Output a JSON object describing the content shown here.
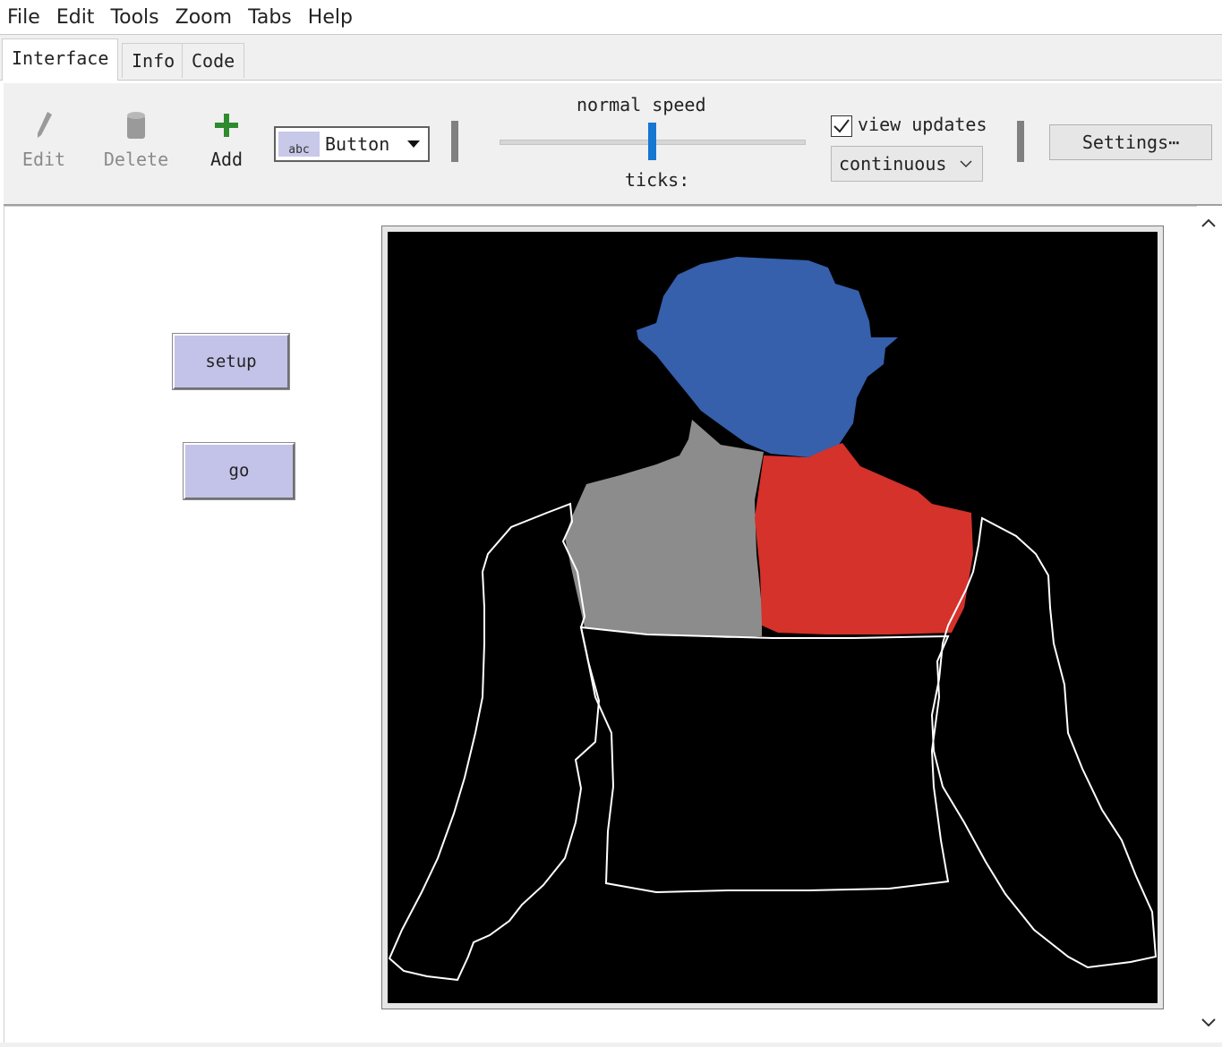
{
  "menu": [
    "File",
    "Edit",
    "Tools",
    "Zoom",
    "Tabs",
    "Help"
  ],
  "tabs": [
    {
      "label": "Interface",
      "active": true
    },
    {
      "label": "Info",
      "active": false
    },
    {
      "label": "Code",
      "active": false
    }
  ],
  "toolbar": {
    "edit_label": "Edit",
    "delete_label": "Delete",
    "add_label": "Add",
    "widget_type": "Button",
    "widget_icon_text": "abc",
    "speed_label": "normal speed",
    "ticks_label": "ticks:",
    "speed_fraction": 0.5,
    "view_updates_label": "view updates",
    "view_updates_checked": true,
    "update_mode": "continuous",
    "settings_label": "Settings⋯"
  },
  "interface": {
    "buttons": [
      {
        "label": "setup"
      },
      {
        "label": "go"
      }
    ],
    "view": {
      "background": "#000000",
      "shapes": [
        {
          "name": "head",
          "color": "#365fac"
        },
        {
          "name": "left-shoulder",
          "color": "#8c8c8c"
        },
        {
          "name": "right-shoulder",
          "color": "#d4322a"
        },
        {
          "name": "torso-outline",
          "color": "#ffffff"
        },
        {
          "name": "left-arm-outline",
          "color": "#ffffff"
        },
        {
          "name": "right-arm-outline",
          "color": "#ffffff"
        }
      ]
    }
  },
  "colors": {
    "button_bg": "#c3c2e8",
    "slider_accent": "#1677d2",
    "add_icon": "#2e8b2e"
  }
}
